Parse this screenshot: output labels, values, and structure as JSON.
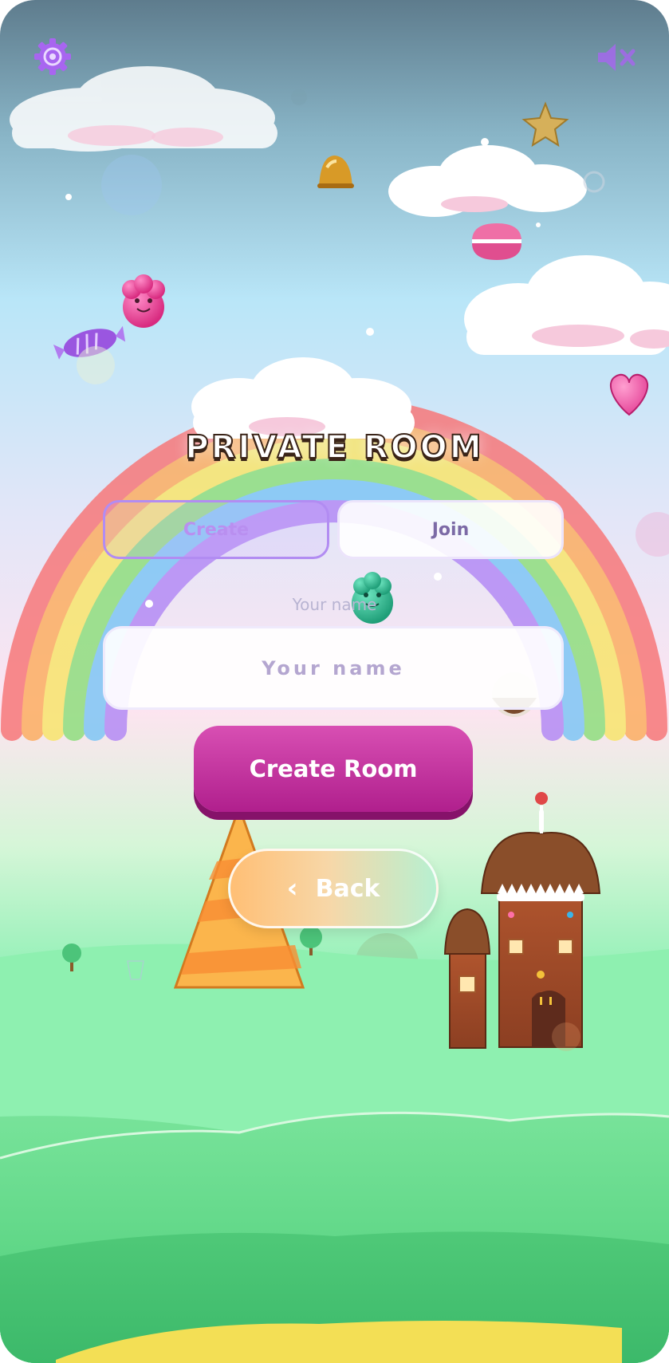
{
  "title": "PRIVATE ROOM",
  "tabs": [
    {
      "label": "Create",
      "active": true
    },
    {
      "label": "Join",
      "active": false
    }
  ],
  "name_field": {
    "label": "Your name",
    "placeholder": "Your name",
    "value": ""
  },
  "create_room_label": "Create Room",
  "back_label": "Back",
  "icons": {
    "settings": "gear-icon",
    "mute": "speaker-muted-icon",
    "back": "chevron-left-icon"
  },
  "colors": {
    "accent_purple": "#a865f0",
    "create_button": "#c0339e",
    "sky_top": "#5f7f8f",
    "sky_mid": "#b7e6f8",
    "grass": "#5ed487"
  }
}
